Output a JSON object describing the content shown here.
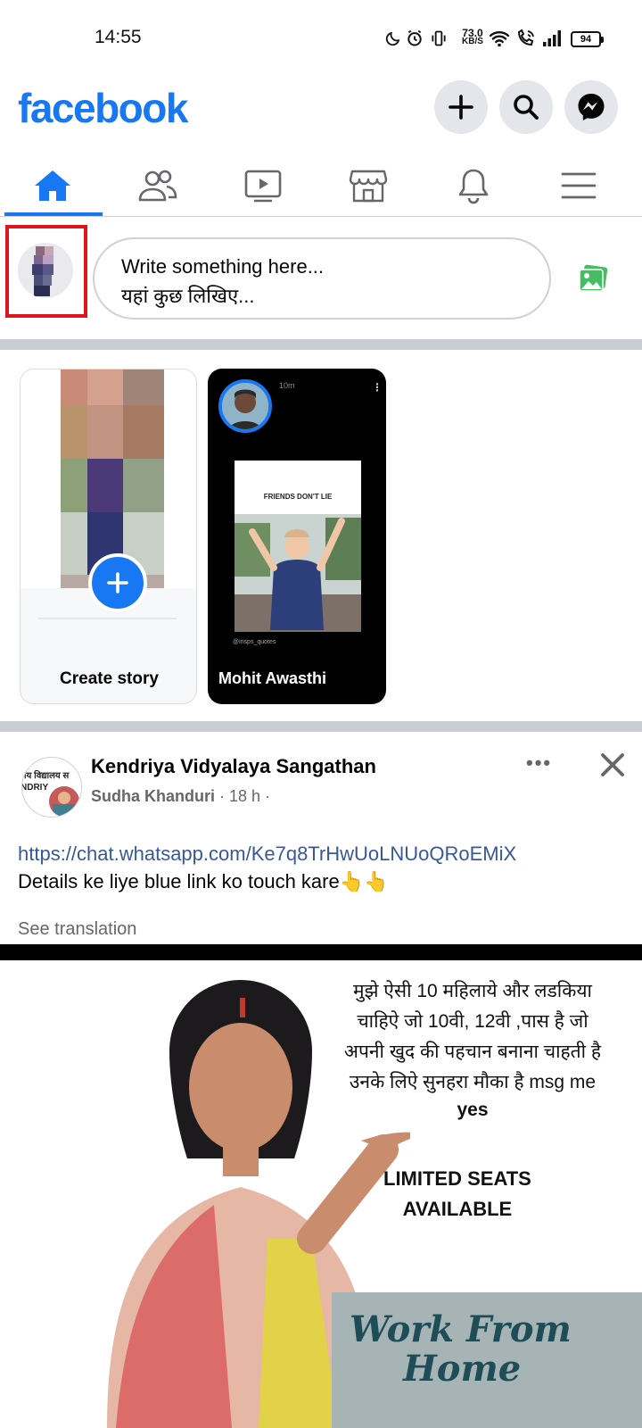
{
  "status_bar": {
    "time": "14:55",
    "net_speed_value": "73.0",
    "net_speed_unit": "KB/S",
    "battery": "94"
  },
  "header": {
    "logo": "facebook",
    "brand_color": "#1877f2"
  },
  "tabs": [
    {
      "icon": "home-icon",
      "active": true
    },
    {
      "icon": "friends-icon",
      "active": false
    },
    {
      "icon": "watch-icon",
      "active": false
    },
    {
      "icon": "marketplace-icon",
      "active": false
    },
    {
      "icon": "bell-icon",
      "active": false
    },
    {
      "icon": "menu-icon",
      "active": false
    }
  ],
  "composer": {
    "placeholder_line1": "Write something here...",
    "placeholder_line2": "यहां कुछ लिखिए..."
  },
  "stories": {
    "create_label": "Create story",
    "story_name": "Mohit Awasthi",
    "story_time": "10m",
    "story_caption": "FRIENDS DON'T LIE",
    "story_handle": "@insps_quotes"
  },
  "post": {
    "group": "Kendriya Vidyalaya Sangathan",
    "author": "Sudha Khanduri",
    "time": "18 h",
    "link": "https://chat.whatsapp.com/Ke7q8TrHwUoLNUoQRoEMiX",
    "text": "Details ke liye blue link ko touch kare👆👆",
    "see_translation": "See translation",
    "avatar_text_1": "ीय विद्यालय स",
    "avatar_text_2": "NDRIY",
    "image_lines": [
      "मुझे ऐसी 10 महिलाये और लडकिया",
      "चाहिऐ जो 10वी, 12वी ,पास है जो",
      "अपनी खुद की पहचान बनाना चाहती है",
      "उनके लिऐ सुनहरा मौका है msg me",
      "yes"
    ],
    "seats_line1": "LIMITED SEATS",
    "seats_line2": "AVAILABLE",
    "wfh_line1": "Work From",
    "wfh_line2": "Home"
  }
}
